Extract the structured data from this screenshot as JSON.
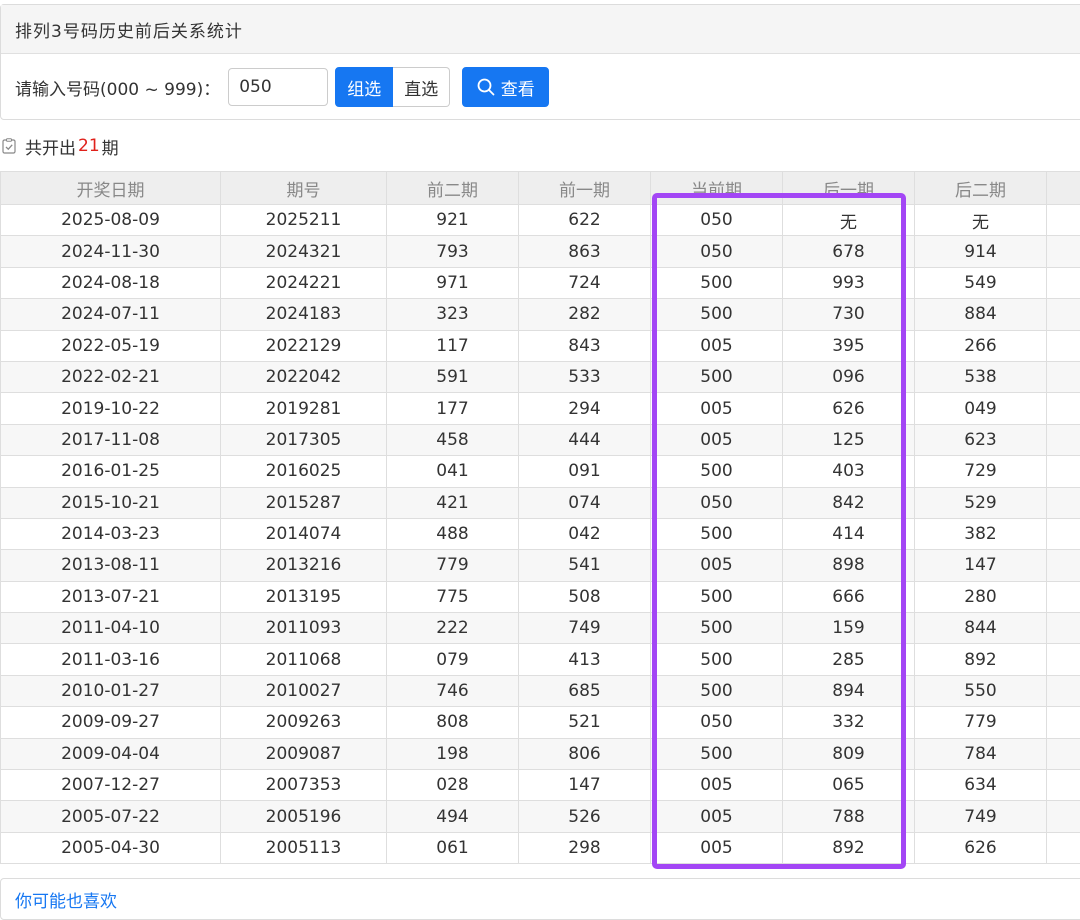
{
  "panel": {
    "title": "排列3号码历史前后关系统计"
  },
  "form": {
    "label": "请输入号码(000 ~ 999)：",
    "value": "050",
    "btn_zu": "组选",
    "btn_zhi": "直选",
    "btn_view": "查看"
  },
  "summary": {
    "prefix": "共开出",
    "count": "21",
    "suffix": "期"
  },
  "table": {
    "headers": [
      "开奖日期",
      "期号",
      "前二期",
      "前一期",
      "当前期",
      "后一期",
      "后二期"
    ],
    "rows": [
      [
        "2025-08-09",
        "2025211",
        "921",
        "622",
        "050",
        "无",
        "无"
      ],
      [
        "2024-11-30",
        "2024321",
        "793",
        "863",
        "050",
        "678",
        "914"
      ],
      [
        "2024-08-18",
        "2024221",
        "971",
        "724",
        "500",
        "993",
        "549"
      ],
      [
        "2024-07-11",
        "2024183",
        "323",
        "282",
        "500",
        "730",
        "884"
      ],
      [
        "2022-05-19",
        "2022129",
        "117",
        "843",
        "005",
        "395",
        "266"
      ],
      [
        "2022-02-21",
        "2022042",
        "591",
        "533",
        "500",
        "096",
        "538"
      ],
      [
        "2019-10-22",
        "2019281",
        "177",
        "294",
        "005",
        "626",
        "049"
      ],
      [
        "2017-11-08",
        "2017305",
        "458",
        "444",
        "005",
        "125",
        "623"
      ],
      [
        "2016-01-25",
        "2016025",
        "041",
        "091",
        "500",
        "403",
        "729"
      ],
      [
        "2015-10-21",
        "2015287",
        "421",
        "074",
        "050",
        "842",
        "529"
      ],
      [
        "2014-03-23",
        "2014074",
        "488",
        "042",
        "500",
        "414",
        "382"
      ],
      [
        "2013-08-11",
        "2013216",
        "779",
        "541",
        "005",
        "898",
        "147"
      ],
      [
        "2013-07-21",
        "2013195",
        "775",
        "508",
        "500",
        "666",
        "280"
      ],
      [
        "2011-04-10",
        "2011093",
        "222",
        "749",
        "500",
        "159",
        "844"
      ],
      [
        "2011-03-16",
        "2011068",
        "079",
        "413",
        "500",
        "285",
        "892"
      ],
      [
        "2010-01-27",
        "2010027",
        "746",
        "685",
        "500",
        "894",
        "550"
      ],
      [
        "2009-09-27",
        "2009263",
        "808",
        "521",
        "050",
        "332",
        "779"
      ],
      [
        "2009-04-04",
        "2009087",
        "198",
        "806",
        "500",
        "809",
        "784"
      ],
      [
        "2007-12-27",
        "2007353",
        "028",
        "147",
        "005",
        "065",
        "634"
      ],
      [
        "2005-07-22",
        "2005196",
        "494",
        "526",
        "005",
        "788",
        "749"
      ],
      [
        "2005-04-30",
        "2005113",
        "061",
        "298",
        "005",
        "892",
        "626"
      ]
    ]
  },
  "footer": {
    "text": "你可能也喜欢"
  },
  "colors": {
    "accent": "#1677f2",
    "highlight": "#a346f5",
    "count": "#e0211b"
  }
}
